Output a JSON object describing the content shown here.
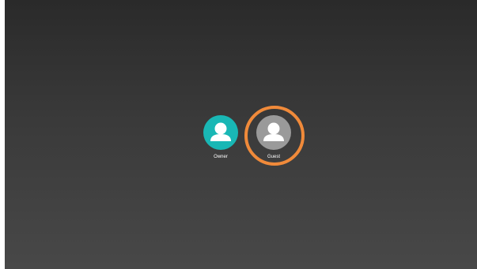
{
  "users": [
    {
      "label": "Owner",
      "avatar_color": "#19b7b5",
      "icon": "person-icon"
    },
    {
      "label": "Guest",
      "avatar_color": "#9a9a9a",
      "icon": "person-icon"
    }
  ],
  "highlight": {
    "target": "Guest",
    "color": "#f08a3a"
  },
  "colors": {
    "background_top": "#2a2a2a",
    "background_bottom": "#484848"
  }
}
